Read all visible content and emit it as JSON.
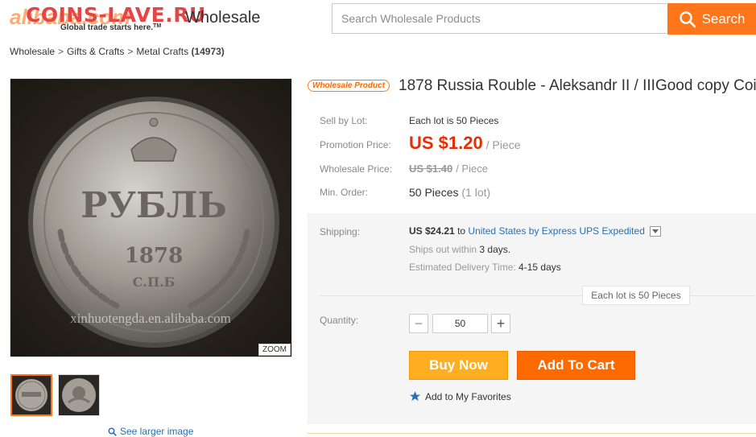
{
  "header": {
    "logo_brand": "alibaba.com",
    "logo_watermark": "COINS-LAVE.RU",
    "logo_tagline": "Global trade starts here.",
    "logo_tm": "TM",
    "section": "Wholesale",
    "search_placeholder": "Search Wholesale Products",
    "search_button": "Search"
  },
  "breadcrumb": {
    "items": [
      "Wholesale",
      "Gifts & Crafts",
      "Metal Crafts"
    ],
    "separator": ">",
    "count": "(14973)"
  },
  "gallery": {
    "zoom_label": "ZOOM",
    "coin_word": "РУБЛЬ",
    "coin_year": "1878",
    "coin_mint": "С.П.Б",
    "watermark": "xinhuotengda.en.alibaba.com",
    "larger_image_link": "See larger image"
  },
  "product": {
    "badge": "Wholesale Product",
    "title": "1878 Russia Rouble - Aleksandr II / IIIGood copy Coi"
  },
  "details": {
    "sell_by_lot_label": "Sell by Lot:",
    "sell_by_lot_value": "Each lot is 50 Pieces",
    "promo_label": "Promotion Price:",
    "promo_price": "US $1.20",
    "promo_unit": "/ Piece",
    "wholesale_label": "Wholesale Price:",
    "wholesale_price": "US $1.40",
    "wholesale_unit": "/ Piece",
    "min_order_label": "Min. Order:",
    "min_order_value": "50 Pieces",
    "min_order_lot": "(1 lot)"
  },
  "shipping": {
    "label": "Shipping:",
    "cost": "US $24.21",
    "to": "to",
    "method": "United States by Express UPS Expedited",
    "ships_out_prefix": "Ships out within",
    "ships_out_days": "3 days.",
    "delivery_prefix": "Estimated Delivery Time:",
    "delivery_days": "4-15 days",
    "lot_tip": "Each lot is 50 Pieces"
  },
  "purchase": {
    "quantity_label": "Quantity:",
    "quantity_value": "50",
    "minus": "−",
    "plus": "+",
    "buy_now": "Buy Now",
    "add_to_cart": "Add To Cart",
    "favorites": "Add to My Favorites"
  },
  "colors": {
    "accent": "#ff7519",
    "price_red": "#e62e04",
    "link_blue": "#2a6fb4",
    "buy_now": "#ffae21",
    "add_to_cart": "#ff6a00"
  }
}
